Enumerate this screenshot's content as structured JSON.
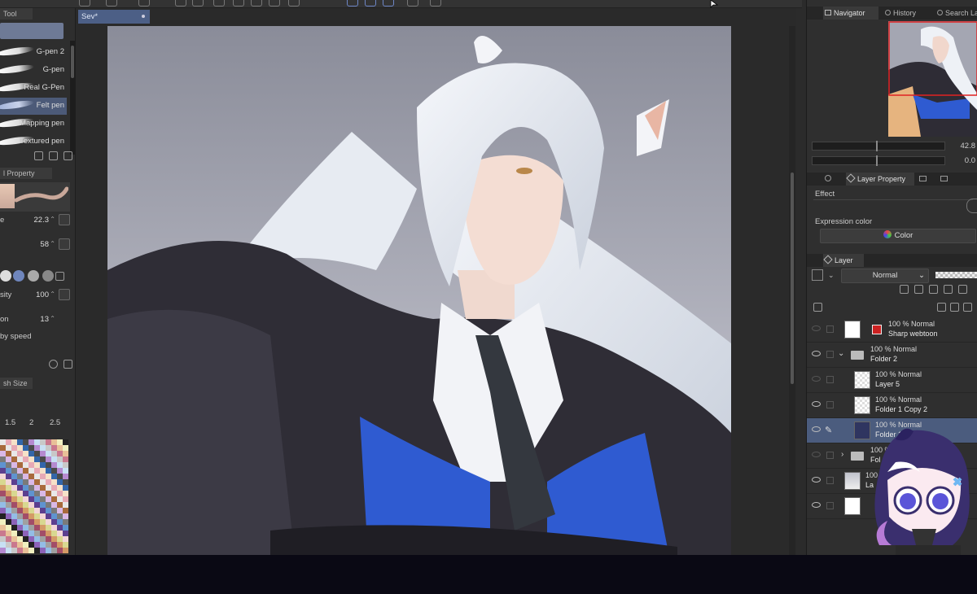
{
  "top_toolbar": {
    "icons": [
      "envelope-icon",
      "rotate-icon",
      "undo-icon",
      "redo-icon",
      "loading-icon",
      "fill-icon",
      "transform-icon",
      "selection-icon",
      "lasso-icon",
      "clear-icon",
      "device-icon",
      "help-icon"
    ]
  },
  "left_panel": {
    "tab_tool": "Tool",
    "brushes": [
      {
        "label": "G-pen 2"
      },
      {
        "label": "G-pen"
      },
      {
        "label": "Real G-Pen"
      },
      {
        "label": "Felt pen",
        "selected": true
      },
      {
        "label": "Mapping pen"
      },
      {
        "label": "Textured pen"
      }
    ],
    "tab_property": "l Property",
    "properties": [
      {
        "label": "e",
        "value": "22.3"
      },
      {
        "label": "",
        "value": "58"
      },
      {
        "label": "sity",
        "value": "100"
      },
      {
        "label": "on",
        "value": "13"
      }
    ],
    "by_speed": "by speed",
    "brush_size_tab": "sh Size",
    "brush_sizes": [
      "1.5",
      "2",
      "2.5"
    ],
    "accent": "#4c5a78"
  },
  "canvas": {
    "doc_tab": "Sev*"
  },
  "right_panel": {
    "nav_tabs": [
      "Navigator",
      "History",
      "Search La"
    ],
    "zoom_value": "42.8",
    "rotate_value": "0.0",
    "prop_tab": "Layer Property",
    "effect_label": "Effect",
    "expression_label": "Expression color",
    "color_button": "Color",
    "layer_tab": "Layer",
    "blend_mode": "Normal",
    "layers": [
      {
        "meta": "100 % Normal",
        "name": "Sharp webtoon",
        "visible": false
      },
      {
        "meta": "100 % Normal",
        "name": "Folder 2",
        "visible": true,
        "folder": true,
        "open": true
      },
      {
        "meta": "100 % Normal",
        "name": "Layer 5",
        "visible": false
      },
      {
        "meta": "100 % Normal",
        "name": "Folder 1 Copy 2",
        "visible": true
      },
      {
        "meta": "100 % Normal",
        "name": "Folder 1 Copy",
        "visible": true,
        "selected": true
      },
      {
        "meta": "100 %",
        "name": "Fol",
        "visible": false,
        "folder": true
      },
      {
        "meta": "100",
        "name": "La",
        "visible": true
      },
      {
        "meta": "",
        "name": "",
        "visible": true
      }
    ],
    "accent": "#4b5c7e"
  }
}
